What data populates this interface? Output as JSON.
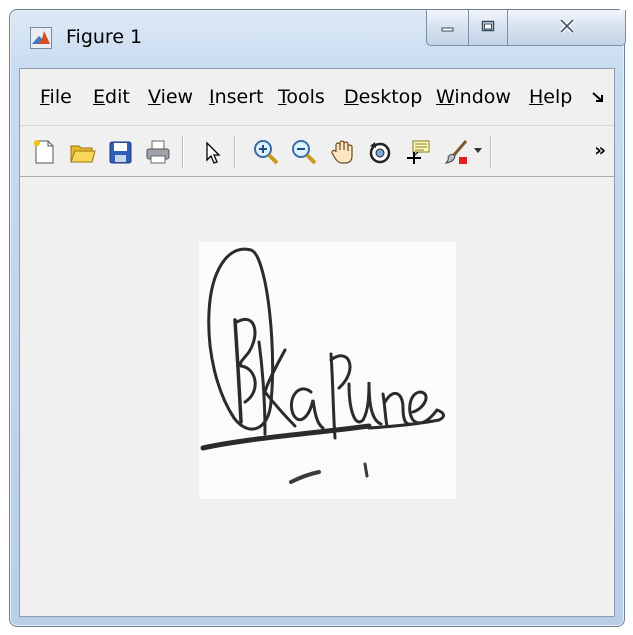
{
  "window": {
    "title": "Figure 1",
    "app_icon": "matlab-figure-icon",
    "caption_buttons": [
      "minimize-icon",
      "maximize-icon",
      "close-icon"
    ]
  },
  "menubar": {
    "items": [
      {
        "mnemonic": "F",
        "rest": "ile"
      },
      {
        "mnemonic": "E",
        "rest": "dit"
      },
      {
        "mnemonic": "V",
        "rest": "iew"
      },
      {
        "mnemonic": "I",
        "rest": "nsert"
      },
      {
        "mnemonic": "T",
        "rest": "ools"
      },
      {
        "mnemonic": "D",
        "rest": "esktop"
      },
      {
        "mnemonic": "W",
        "rest": "indow"
      },
      {
        "mnemonic": "H",
        "rest": "elp"
      }
    ],
    "overflow_icon": "menu-overflow-arrow-icon"
  },
  "toolbar": {
    "buttons": [
      "new-figure-icon",
      "open-file-icon",
      "save-figure-icon",
      "print-figure-icon",
      "edit-plot-arrow-icon",
      "zoom-in-icon",
      "zoom-out-icon",
      "pan-hand-icon",
      "rotate-3d-icon",
      "data-cursor-icon",
      "brush-data-icon"
    ],
    "overflow_label": "»"
  },
  "figure": {
    "image_content": "handwritten-signature",
    "signature_text": "BKaPune"
  }
}
